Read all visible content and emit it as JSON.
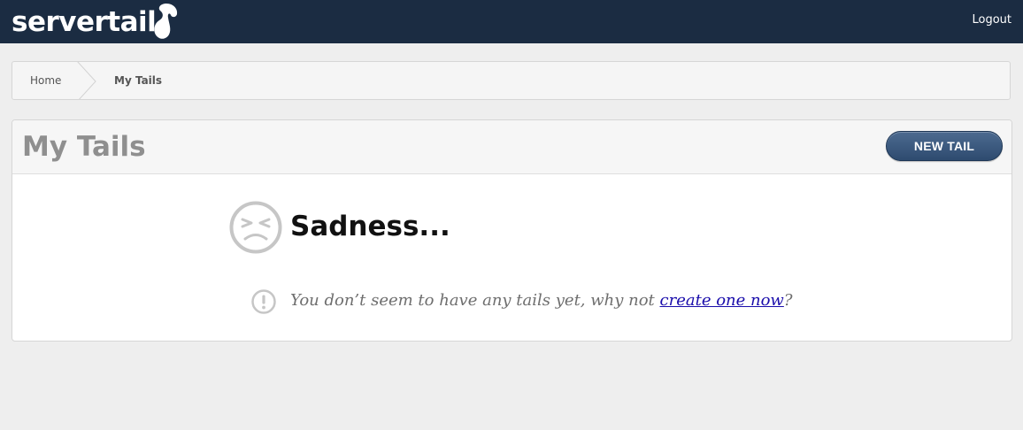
{
  "header": {
    "logo_text": "servertail",
    "logout_label": "Logout"
  },
  "breadcrumb": {
    "items": [
      "Home",
      "My Tails"
    ]
  },
  "panel": {
    "title": "My Tails",
    "new_button_label": "NEW TAIL"
  },
  "empty_state": {
    "heading": "Sadness...",
    "message_prefix": "You don’t seem to have any tails yet, why not ",
    "link_label": "create one now",
    "message_suffix": "?"
  },
  "icons": {
    "logo": "squirrel-tail-icon",
    "empty_state": "sad-face-icon",
    "message": "exclamation-circle-icon"
  },
  "colors": {
    "topbar": "#1b2c42",
    "button": "#2e4b6f",
    "link": "#1a0dab"
  }
}
